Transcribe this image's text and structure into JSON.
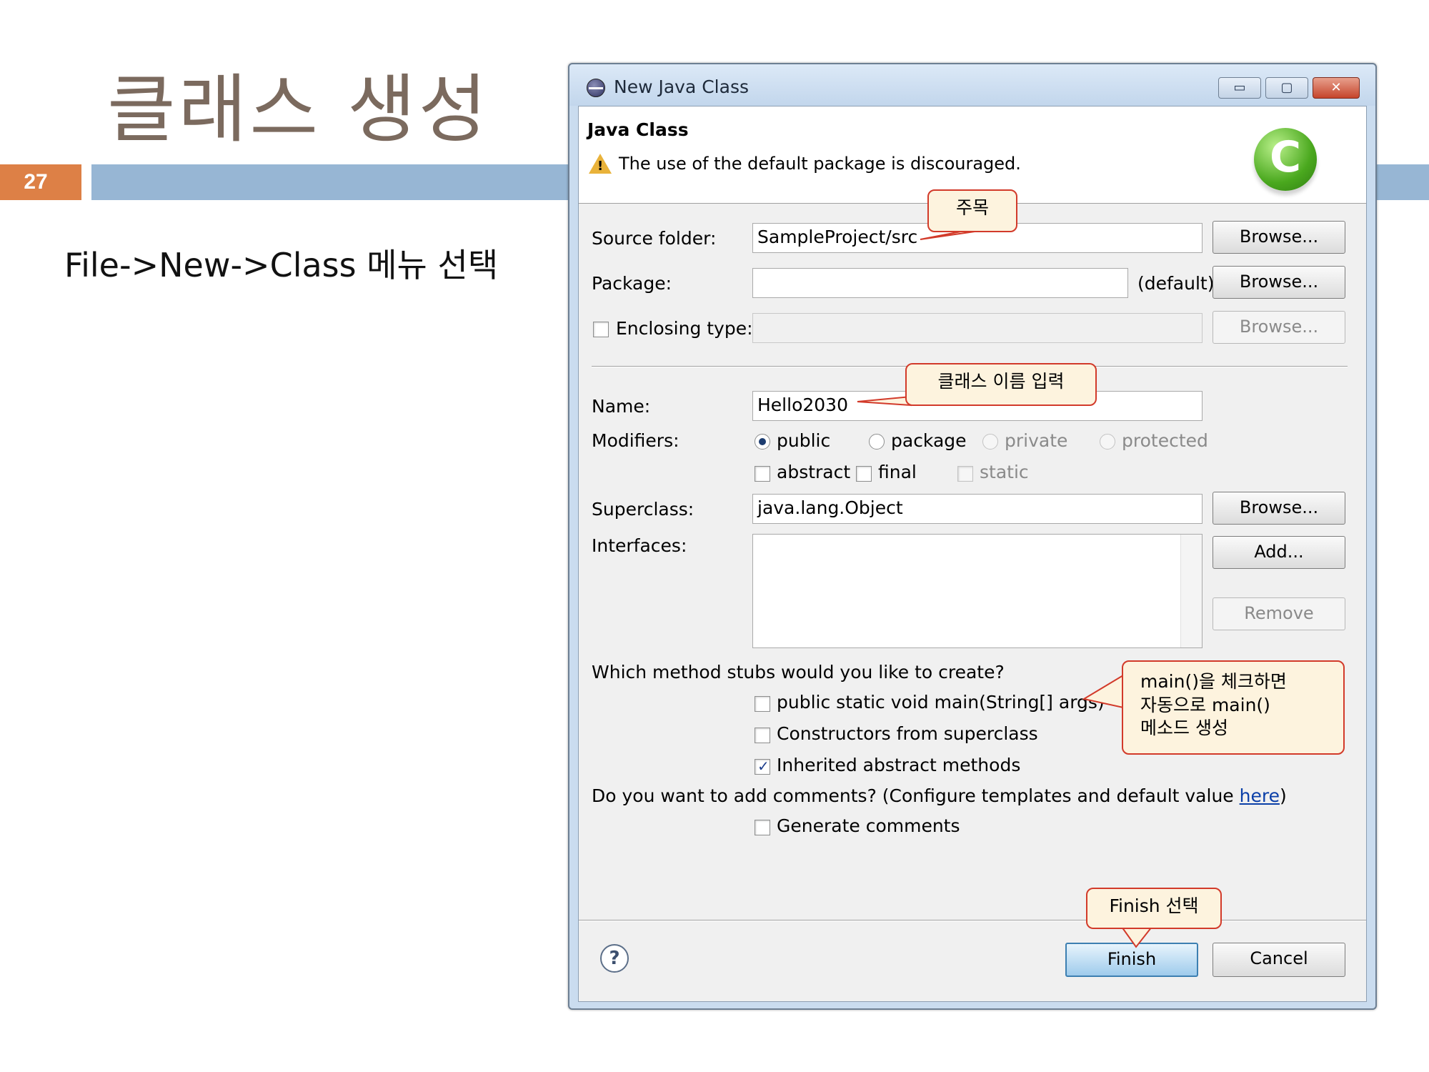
{
  "slide": {
    "title": "클래스 생성",
    "page_number": "27",
    "instruction": "File->New->Class 메뉴 선택"
  },
  "dialog": {
    "window_title": "New Java Class",
    "window_controls": {
      "minimize": "▭",
      "maximize": "▢",
      "close": "✕"
    },
    "header_title": "Java Class",
    "header_message": "The use of the default package is discouraged.",
    "source_folder": {
      "label": "Source folder:",
      "value": "SampleProject/src",
      "browse": "Browse..."
    },
    "package": {
      "label": "Package:",
      "value": "",
      "suffix": "(default)",
      "browse": "Browse..."
    },
    "enclosing_type": {
      "label": "Enclosing type:",
      "checked": false,
      "value": "",
      "browse": "Browse..."
    },
    "name": {
      "label": "Name:",
      "value": "Hello2030"
    },
    "modifiers": {
      "label": "Modifiers:",
      "access": [
        {
          "label": "public",
          "selected": true,
          "enabled": true
        },
        {
          "label": "package",
          "selected": false,
          "enabled": true
        },
        {
          "label": "private",
          "selected": false,
          "enabled": false
        },
        {
          "label": "protected",
          "selected": false,
          "enabled": false
        }
      ],
      "other": [
        {
          "label": "abstract",
          "checked": false,
          "enabled": true
        },
        {
          "label": "final",
          "checked": false,
          "enabled": true
        },
        {
          "label": "static",
          "checked": false,
          "enabled": false
        }
      ]
    },
    "superclass": {
      "label": "Superclass:",
      "value": "java.lang.Object",
      "browse": "Browse..."
    },
    "interfaces": {
      "label": "Interfaces:",
      "add": "Add...",
      "remove": "Remove"
    },
    "stubs": {
      "question": "Which method stubs would you like to create?",
      "options": [
        {
          "label": "public static void main(String[] args)",
          "checked": false
        },
        {
          "label": "Constructors from superclass",
          "checked": false
        },
        {
          "label": "Inherited abstract methods",
          "checked": true
        }
      ]
    },
    "comments": {
      "question_prefix": "Do you want to add comments? (Configure templates and default value ",
      "link": "here",
      "question_suffix": ")",
      "option": {
        "label": "Generate comments",
        "checked": false
      }
    },
    "help": "?",
    "finish": "Finish",
    "cancel": "Cancel"
  },
  "callouts": {
    "attention": "주목",
    "enter_class_name": "클래스 이름 입력",
    "main_note_line1": "main()을 체크하면",
    "main_note_line2": "자동으로 main()",
    "main_note_line3": "메소드 생성",
    "finish_select": "Finish 선택"
  },
  "colors": {
    "title_text": "#7b6a5e",
    "page_number_bg": "#dd8046",
    "slide_bar": "#97b6d4",
    "callout_border": "#d23a2a",
    "callout_fill": "#fdf3de"
  }
}
